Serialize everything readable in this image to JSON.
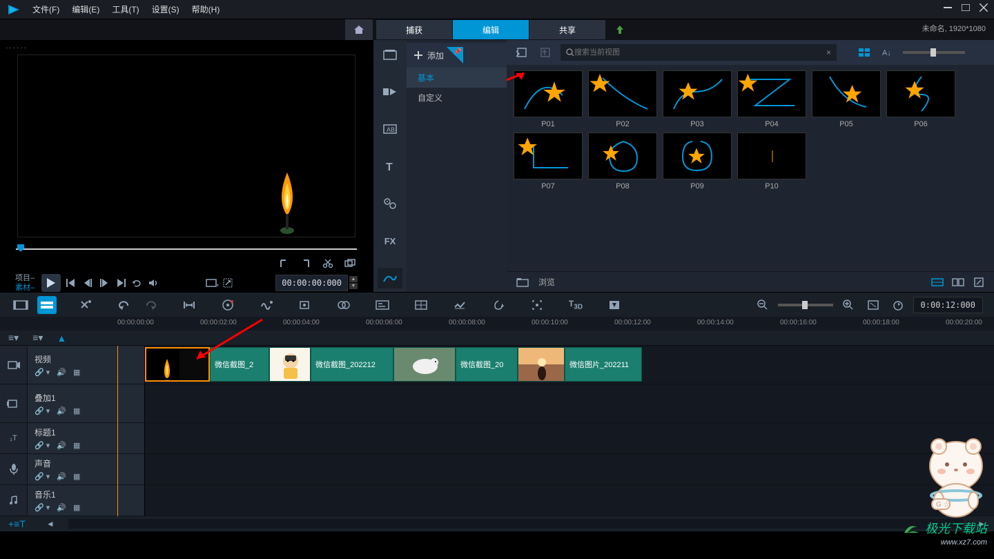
{
  "menu": {
    "file": "文件(F)",
    "edit": "编辑(E)",
    "tools": "工具(T)",
    "settings": "设置(S)",
    "help": "帮助(H)"
  },
  "tabs": {
    "capture": "捕获",
    "edit": "编辑",
    "share": "共享"
  },
  "doc": {
    "name": "未命名",
    "resolution": "1920*1080"
  },
  "preview": {
    "title": "······",
    "label_project": "项目",
    "label_clip": "素材",
    "timecode": "00:00:00:000"
  },
  "library": {
    "add": "添加",
    "cat_basic": "基本",
    "cat_custom": "自定义",
    "search_placeholder": "搜索当前视图",
    "browse": "浏览",
    "fx_label": "FX",
    "thumbs_row1": [
      "P01",
      "P02",
      "P03",
      "P04",
      "P05",
      "P06"
    ],
    "thumbs_row2": [
      "P07",
      "P08",
      "P09",
      "P10"
    ]
  },
  "timeline": {
    "time_display": "0:00:12:000",
    "ruler": [
      "00:00:00:00",
      "00:00:02:00",
      "00:00:04:00",
      "00:00:06:00",
      "00:00:08:00",
      "00:00:10:00",
      "00:00:12:00",
      "00:00:14:00",
      "00:00:16:00",
      "00:00:18:00",
      "00:00:20:00"
    ],
    "tracks": {
      "video": "视频",
      "overlay": "叠加1",
      "title": "标题1",
      "voice": "声音",
      "music": "音乐1"
    },
    "clips": {
      "c1": "微信截图_2",
      "c2": "微信截图_202212",
      "c3": "微信截图_20",
      "c4": "微信图片_202211"
    },
    "t3d": "3D"
  },
  "watermark": {
    "brand": "极光下载站",
    "url": "www.xz7.com"
  },
  "mascot_badge": "G ☆"
}
